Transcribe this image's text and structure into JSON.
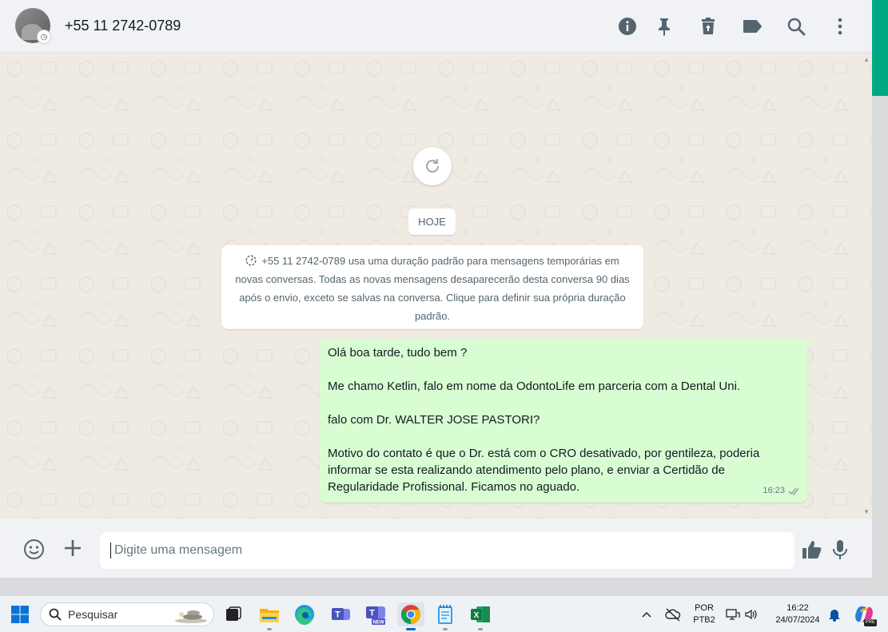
{
  "header": {
    "contact_name": "+55 11 2742-0789",
    "icons": [
      "info-icon",
      "pin-icon",
      "delete-icon",
      "label-icon",
      "search-icon",
      "menu-icon"
    ]
  },
  "chat": {
    "date_chip": "HOJE",
    "system_message": "+55 11 2742-0789 usa uma duração padrão para mensagens temporárias em novas conversas. Todas as novas mensagens desaparecerão desta conversa 90 dias após o envio, exceto se salvas na conversa. Clique para definir sua própria duração padrão.",
    "outgoing_message": {
      "lines": [
        "Olá boa tarde, tudo bem ?",
        "Me chamo Ketlin, falo em nome da OdontoLife em parceria com a Dental Uni.",
        "falo com Dr. WALTER JOSE PASTORI?",
        "Motivo do contato é que o Dr. está com o CRO desativado, por gentileza, poderia informar se esta realizando atendimento pelo plano, e enviar a Certidão de Regularidade Profissional. Ficamos no aguado."
      ],
      "time": "16:23",
      "status_icon": "double-check-icon"
    }
  },
  "composer": {
    "placeholder": "Digite uma mensagem",
    "icons": [
      "emoji-icon",
      "plus-icon",
      "thumbs-up-icon",
      "mic-icon"
    ]
  },
  "taskbar": {
    "search_label": "Pesquisar",
    "apps": [
      "start-icon",
      "task-view-icon",
      "file-explorer-icon",
      "edge-icon",
      "teams-icon",
      "teams-new-icon",
      "chrome-icon",
      "notepad-icon",
      "excel-icon"
    ],
    "active_app": "chrome-icon",
    "language_line1": "POR",
    "language_line2": "PTB2",
    "clock_time": "16:22",
    "clock_date": "24/07/2024",
    "copilot_badge": "PRE"
  },
  "colors": {
    "accent": "#00a884",
    "outgoing_bubble": "#d9fdd3",
    "chat_bg": "#efeae2",
    "header_bg": "#f0f2f5"
  }
}
